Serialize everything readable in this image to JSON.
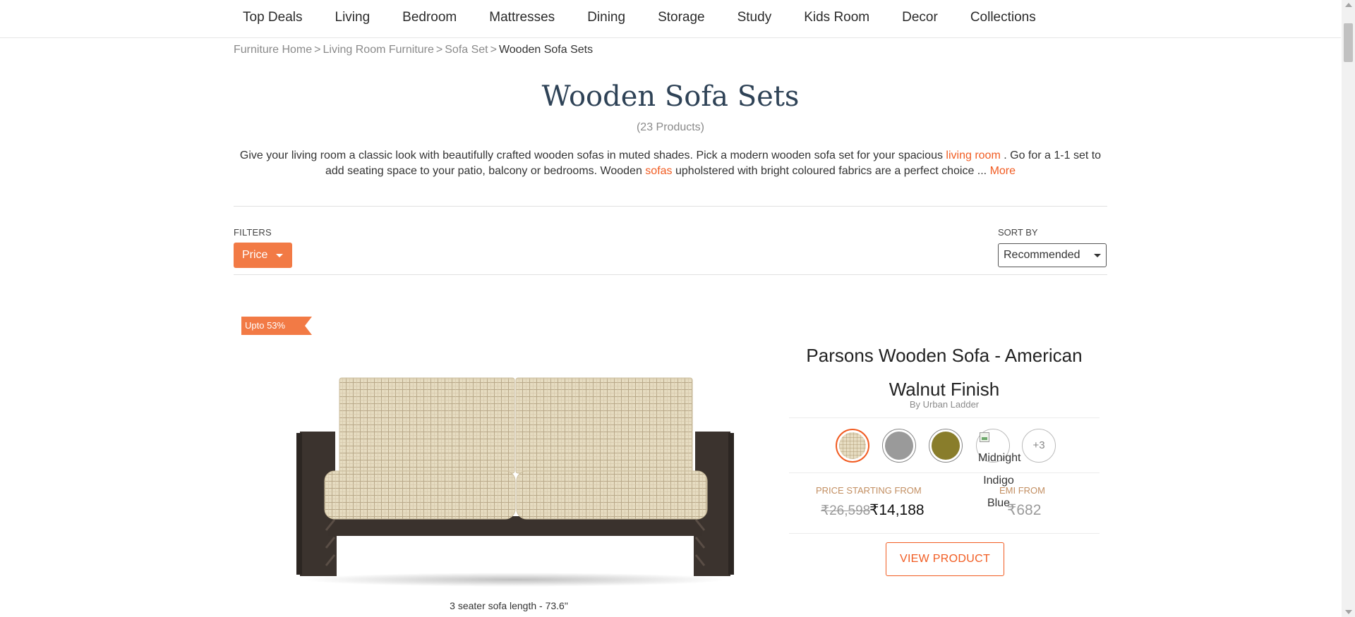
{
  "nav": {
    "items": [
      "Top Deals",
      "Living",
      "Bedroom",
      "Mattresses",
      "Dining",
      "Storage",
      "Study",
      "Kids Room",
      "Decor",
      "Collections"
    ]
  },
  "breadcrumb": {
    "items": [
      "Furniture Home",
      "Living Room Furniture",
      "Sofa Set"
    ],
    "separator": ">",
    "current": "Wooden Sofa Sets"
  },
  "category": {
    "title": "Wooden Sofa Sets",
    "count": "(23 Products)",
    "description": {
      "part1": "Give your living room a classic look with beautifully crafted wooden sofas in muted shades. Pick a modern wooden sofa set for your spacious",
      "link1": "living room",
      "part2": ". Go for a 1-1 set to add seating space to your patio, balcony or bedrooms. Wooden",
      "link2": "sofas",
      "part3": "upholstered with bright coloured fabrics are a perfect choice ...",
      "more": "More"
    }
  },
  "filters": {
    "label": "FILTERS",
    "price_button": "Price",
    "sort_label": "SORT BY",
    "sort_value": "Recommended"
  },
  "product": {
    "badge": "Upto 53%",
    "title": "Parsons Wooden Sofa - American Walnut Finish",
    "brand": "By Urban Ladder",
    "swatch_more": "+3",
    "swatch_broken_alt": "Midnight Indigo Blue",
    "price_label": "PRICE STARTING FROM",
    "mrp": "₹26,598",
    "price": "₹14,188",
    "emi_label": "EMI FROM",
    "emi": "₹682",
    "view_button": "VIEW PRODUCT",
    "dimension": "3 seater sofa length - 73.6\""
  },
  "colors": {
    "accent": "#f15c22",
    "filter_button": "#f27a45",
    "title": "#2e4256",
    "price_label": "#c28e61",
    "frame": "#3b332e",
    "fabric": "#e6dcc1"
  },
  "icons": [
    "caret-down-icon",
    "broken-image-icon",
    "sofa-product-image",
    "badge-ribbon"
  ]
}
